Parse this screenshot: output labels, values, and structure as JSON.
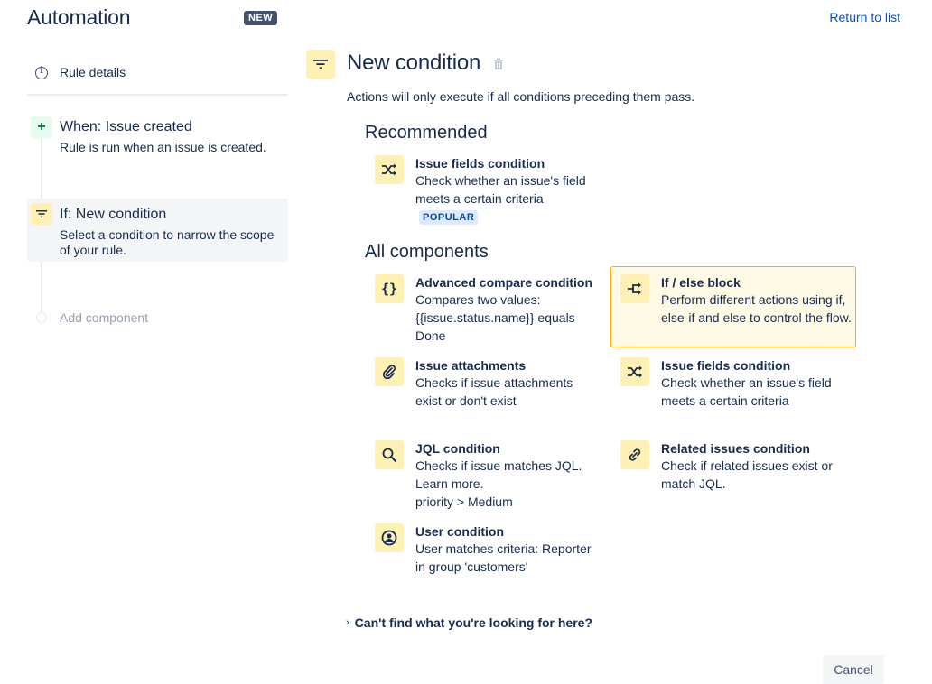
{
  "header": {
    "app_title": "Automation",
    "new_badge": "NEW",
    "return_link": "Return to list"
  },
  "sidebar": {
    "rule_details": "Rule details",
    "steps": [
      {
        "title": "When: Issue created",
        "description": "Rule is run when an issue is created.",
        "icon": "plus-icon"
      },
      {
        "title": "If: New condition",
        "description": "Select a condition to narrow the scope of your rule.",
        "icon": "filter-icon"
      }
    ],
    "add_component": "Add component"
  },
  "main": {
    "title": "New condition",
    "subtitle": "Actions will only execute if all conditions preceding them pass.",
    "recommended_heading": "Recommended",
    "recommended": [
      {
        "title": "Issue fields condition",
        "description": "Check whether an issue's field meets a certain criteria",
        "badge": "POPULAR",
        "icon": "shuffle-icon"
      }
    ],
    "all_heading": "All components",
    "components": [
      {
        "title": "Advanced compare condition",
        "description": "Compares two values: {{issue.status.name}} equals Done",
        "icon": "braces-icon"
      },
      {
        "title": "If / else block",
        "description": "Perform different actions using if, else-if and else to control the flow.",
        "icon": "branch-icon",
        "selected": true
      },
      {
        "title": "Issue attachments",
        "description": "Checks if issue attachments exist or don't exist",
        "icon": "paperclip-icon"
      },
      {
        "title": "Issue fields condition",
        "description": "Check whether an issue's field meets a certain criteria",
        "icon": "shuffle-icon"
      },
      {
        "title": "JQL condition",
        "description": "Checks if issue matches JQL. Learn more.",
        "description2": "priority > Medium",
        "icon": "search-icon"
      },
      {
        "title": "Related issues condition",
        "description": "Check if related issues exist or match JQL.",
        "icon": "link-icon"
      },
      {
        "title": "User condition",
        "description": "User matches criteria: Reporter in group 'customers'",
        "icon": "user-icon"
      }
    ],
    "cant_find": "Can't find what you're looking for here?",
    "cancel": "Cancel"
  },
  "colors": {
    "text": "#172b4d",
    "link": "#0052cc",
    "icon_bg": "#fff0b3",
    "selected_border": "#ffab00",
    "selected_bg": "#fffae6"
  }
}
